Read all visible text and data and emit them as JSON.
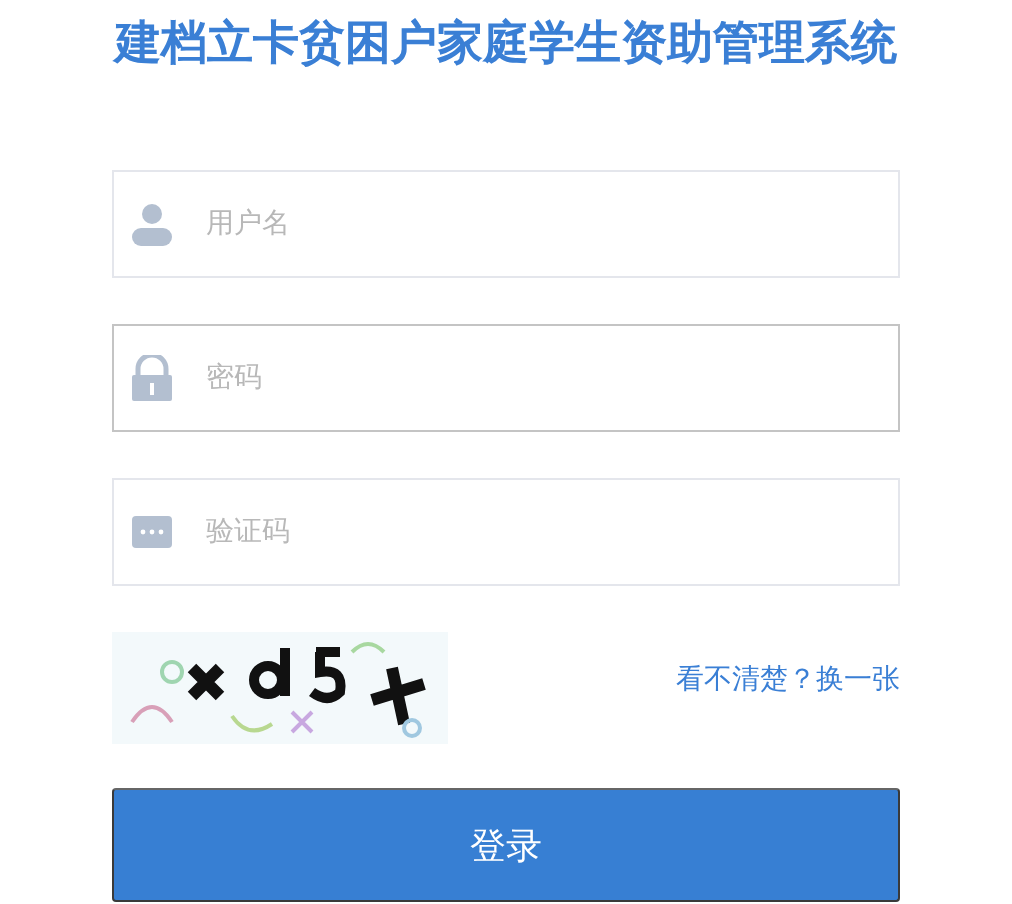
{
  "title": "建档立卡贫困户家庭学生资助管理系统",
  "fields": [
    {
      "kind": "user",
      "placeholder": "用户名",
      "focused": false
    },
    {
      "kind": "lock",
      "placeholder": "密码",
      "focused": true
    },
    {
      "kind": "code",
      "placeholder": "验证码",
      "focused": false
    }
  ],
  "captcha": {
    "kind": "picture",
    "refresh_link": "看不清楚？换一张"
  },
  "login_button": "登录"
}
